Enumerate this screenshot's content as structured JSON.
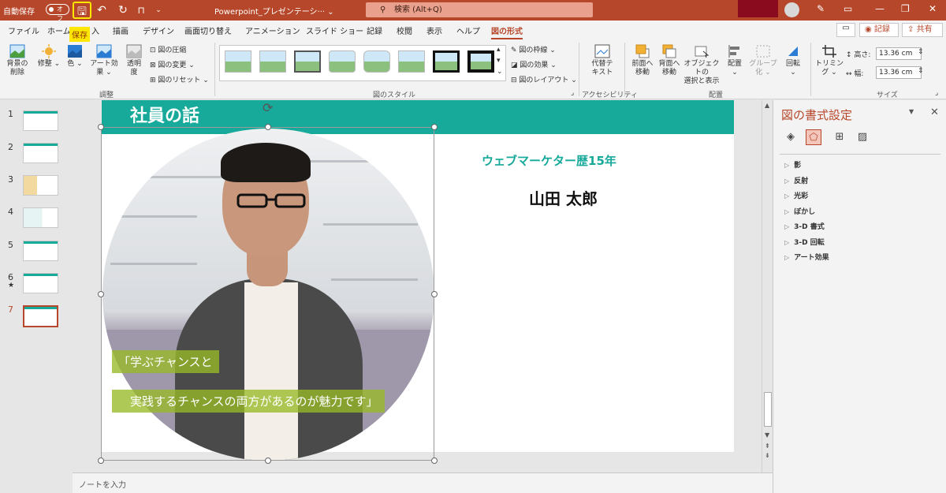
{
  "titlebar": {
    "autosave_label": "自動保存",
    "autosave_toggle": "オフ",
    "document_title": "Powerpoint_プレゼンテーシ··· ",
    "document_title_caret": "⌄",
    "search_placeholder": "検索 (Alt+Q)",
    "save_tooltip": "保存"
  },
  "tabs": [
    {
      "label": "ファイル"
    },
    {
      "label": "ホーム"
    },
    {
      "label": "入"
    },
    {
      "label": "描画"
    },
    {
      "label": "デザイン"
    },
    {
      "label": "画面切り替え"
    },
    {
      "label": "アニメーション"
    },
    {
      "label": "スライド ショー"
    },
    {
      "label": "記録"
    },
    {
      "label": "校閲"
    },
    {
      "label": "表示"
    },
    {
      "label": "ヘルプ"
    },
    {
      "label": "図の形式"
    }
  ],
  "header_buttons": {
    "record": "記録",
    "share": "共有"
  },
  "ribbon": {
    "remove_background": "背景の\n削除",
    "corrections": "修整",
    "color": "色",
    "artistic_effects": "アート効果",
    "transparency": "透明\n度",
    "compress": "図の圧縮",
    "change_picture": "図の変更",
    "reset_picture": "図のリセット",
    "group_adjust": "調整",
    "picture_border": "図の枠線",
    "picture_effects": "図の効果",
    "picture_layout": "図のレイアウト",
    "group_styles": "図のスタイル",
    "alt_text": "代替テ\nキスト",
    "group_accessibility": "アクセシビリティ",
    "bring_forward": "前面へ\n移動",
    "send_backward": "背面へ\n移動",
    "selection_pane": "オブジェクトの\n選択と表示",
    "align": "配置",
    "group": "グループ化",
    "rotate": "回転",
    "group_arrange": "配置",
    "crop": "トリミング",
    "height_label": "高さ:",
    "height_value": "13.36 cm",
    "width_label": "幅:",
    "width_value": "13.36 cm",
    "group_size": "サイズ"
  },
  "thumbnails": [
    {
      "num": "1"
    },
    {
      "num": "2"
    },
    {
      "num": "3"
    },
    {
      "num": "4"
    },
    {
      "num": "5"
    },
    {
      "num": "6"
    },
    {
      "num": "7"
    }
  ],
  "slide": {
    "title": "社員の話",
    "career": "ウェブマーケター歴15年",
    "name": "山田 太郎",
    "quote_line1": "「学ぶチャンスと",
    "quote_line2": "　実践するチャンスの両方があるのが魅力です」"
  },
  "notes_placeholder": "ノートを入力",
  "format_pane": {
    "title": "図の書式設定",
    "items": [
      {
        "label": "影"
      },
      {
        "label": "反射"
      },
      {
        "label": "光彩"
      },
      {
        "label": "ぼかし"
      },
      {
        "label": "3-D 書式"
      },
      {
        "label": "3-D 回転"
      },
      {
        "label": "アート効果"
      }
    ]
  },
  "colors": {
    "accent": "#b7472a",
    "slide_header": "#17a99a",
    "quote_bg": "#98ba28"
  }
}
